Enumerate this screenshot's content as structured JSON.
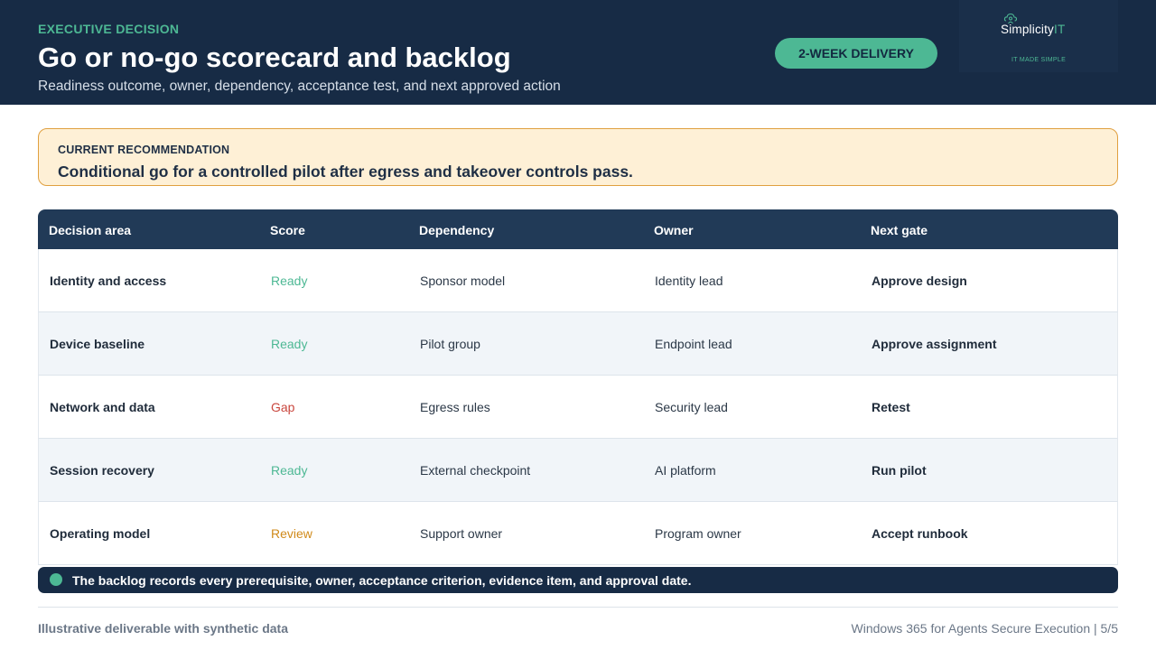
{
  "header": {
    "eyebrow": "EXECUTIVE DECISION",
    "title": "Go or no-go scorecard and backlog",
    "subtitle": "Readiness outcome, owner, dependency, acceptance test, and next approved action",
    "badge": "2-WEEK DELIVERY",
    "logo": {
      "name_main": "Simplicity",
      "name_accent": "IT",
      "tagline": "IT MADE SIMPLE",
      "icon": "cloud-person-icon"
    }
  },
  "recommendation": {
    "label": "CURRENT RECOMMENDATION",
    "text": "Conditional go for a controlled pilot after egress and takeover controls pass."
  },
  "table": {
    "columns": [
      "Decision area",
      "Score",
      "Dependency",
      "Owner",
      "Next gate"
    ],
    "rows": [
      {
        "area": "Identity and access",
        "score": "Ready",
        "dependency": "Sponsor model",
        "owner": "Identity lead",
        "gate": "Approve design"
      },
      {
        "area": "Device baseline",
        "score": "Ready",
        "dependency": "Pilot group",
        "owner": "Endpoint lead",
        "gate": "Approve assignment"
      },
      {
        "area": "Network and data",
        "score": "Gap",
        "dependency": "Egress rules",
        "owner": "Security lead",
        "gate": "Retest"
      },
      {
        "area": "Session recovery",
        "score": "Ready",
        "dependency": "External checkpoint",
        "owner": "AI platform",
        "gate": "Run pilot"
      },
      {
        "area": "Operating model",
        "score": "Review",
        "dependency": "Support owner",
        "owner": "Program owner",
        "gate": "Accept runbook"
      }
    ]
  },
  "score_colors": {
    "Ready": "#4db894",
    "Gap": "#c9473e",
    "Review": "#d08a1a"
  },
  "note": "The backlog records every prerequisite, owner, acceptance criterion, evidence item, and approval date.",
  "footer": {
    "left": "Illustrative deliverable with synthetic data",
    "right": "Windows 365 for Agents Secure Execution | 5/5"
  },
  "colors": {
    "navy": "#172b45",
    "accent_green": "#4db894",
    "recommendation_bg": "#fef0d6",
    "recommendation_border": "#e0a040"
  }
}
